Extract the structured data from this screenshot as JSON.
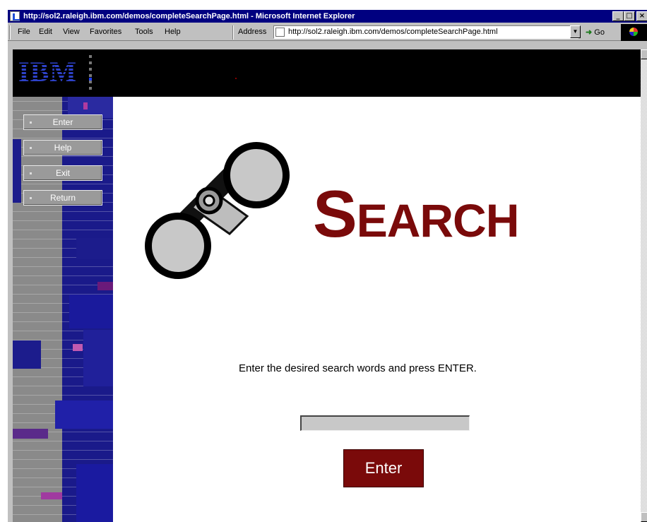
{
  "window": {
    "title": "http://sol2.raleigh.ibm.com/demos/completeSearchPage.html - Microsoft Internet Explorer",
    "minimize": "_",
    "maximize": "□",
    "close": "×"
  },
  "menu": {
    "items": [
      "File",
      "Edit",
      "View",
      "Favorites",
      "Tools",
      "Help"
    ],
    "address_label": "Address",
    "address_url": "http://sol2.raleigh.ibm.com/demos/completeSearchPage.html",
    "go_label": "Go"
  },
  "banner": {
    "logo_text": "IBM"
  },
  "sidebar": {
    "buttons": [
      "Enter",
      "Help",
      "Exit",
      "Return"
    ]
  },
  "main": {
    "heading_cap": "S",
    "heading_rest": "EARCH",
    "instruction": "Enter the desired search words and press ENTER.",
    "search_value": "",
    "enter_label": "Enter"
  },
  "icons": [
    "ie-page-icon",
    "binoculars-icon",
    "ie-logo-icon",
    "dropdown-arrow-icon",
    "go-arrow-icon"
  ],
  "colors": {
    "accent": "#7a0a0a",
    "titlebar": "#000080",
    "banner": "#000000",
    "ibm_blue": "#1f33b8"
  }
}
